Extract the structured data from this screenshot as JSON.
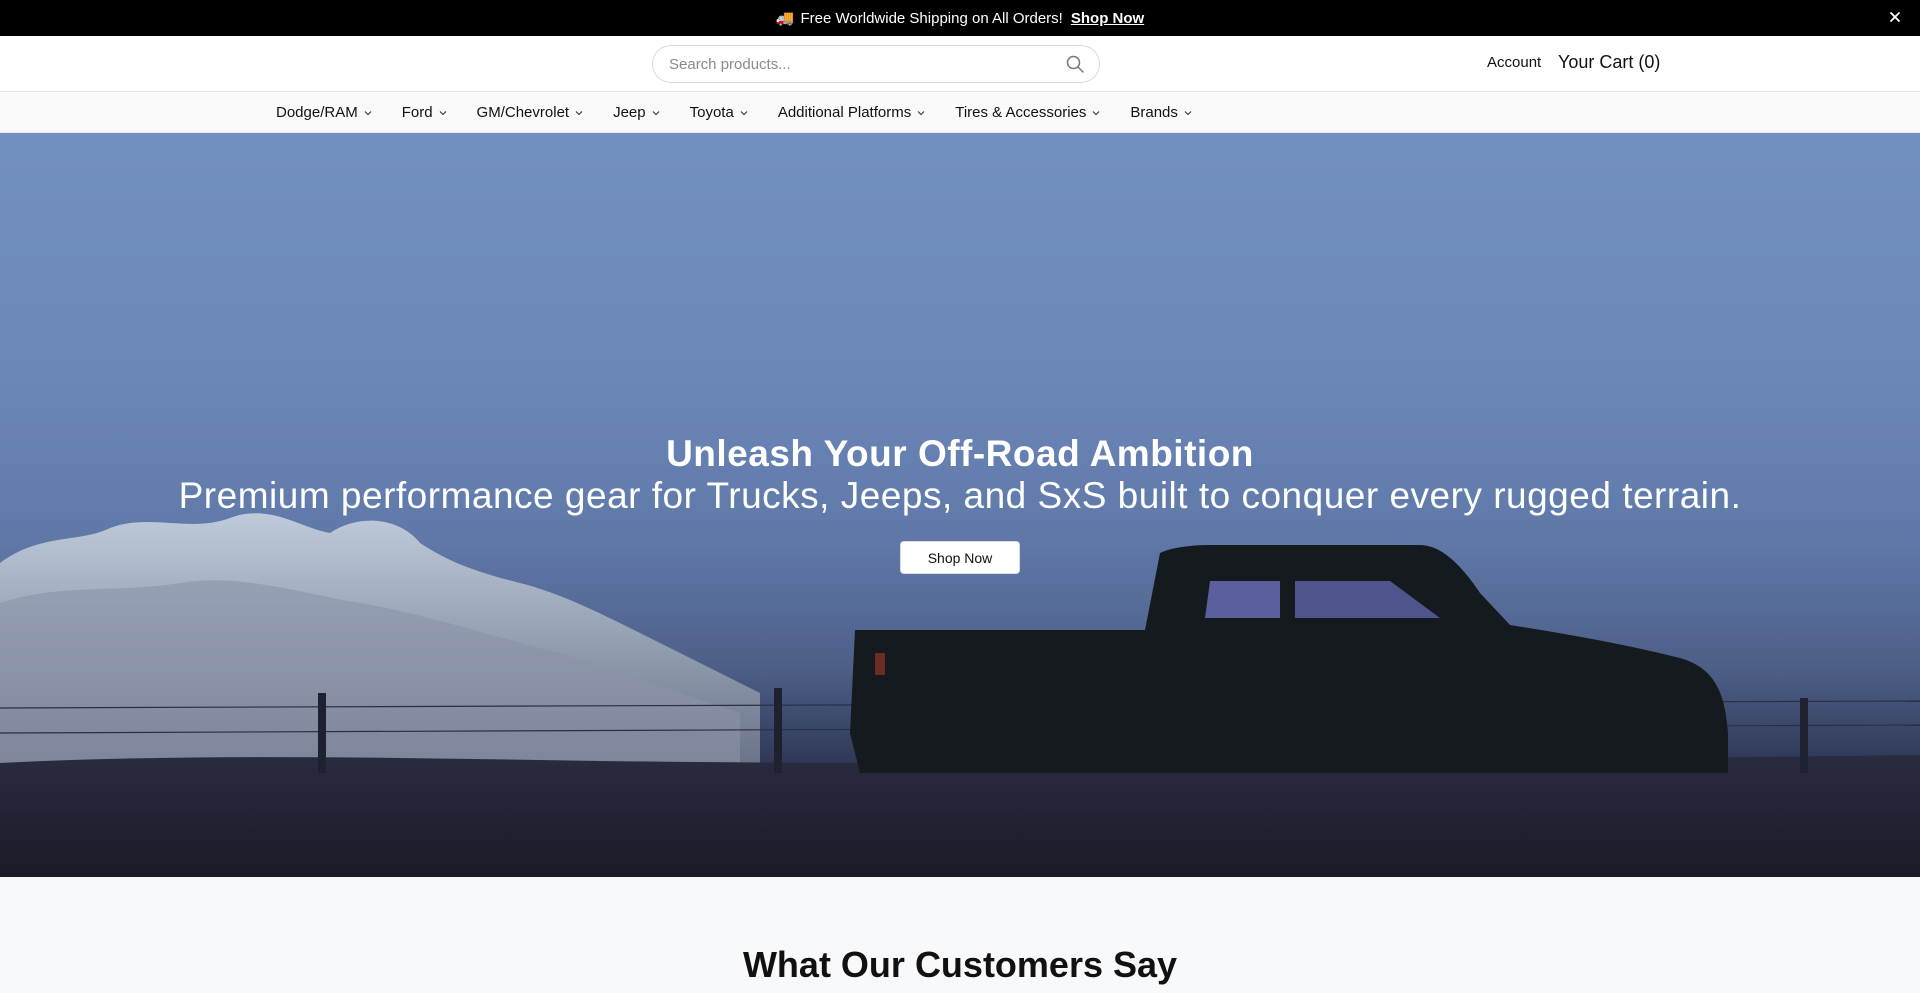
{
  "announcement": {
    "icon": "truck-icon",
    "message": "Free Worldwide Shipping on All Orders!",
    "link": "Shop Now",
    "close_icon": "close-icon"
  },
  "header": {
    "search_placeholder": "Search products...",
    "search_icon": "search-icon",
    "account": "Account",
    "cart": "Your Cart (0)"
  },
  "nav": {
    "items": [
      {
        "label": "Dodge/RAM"
      },
      {
        "label": "Ford"
      },
      {
        "label": "GM/Chevrolet"
      },
      {
        "label": "Jeep"
      },
      {
        "label": "Toyota"
      },
      {
        "label": "Additional Platforms"
      },
      {
        "label": "Tires & Accessories"
      },
      {
        "label": "Brands"
      }
    ]
  },
  "hero": {
    "headline": "Unleash Your Off-Road Ambition",
    "subline": "Premium performance gear for Trucks, Jeeps, and SxS built to conquer every rugged terrain.",
    "cta": "Shop Now"
  },
  "testimonials": {
    "title": "What Our Customers Say"
  },
  "colors": {
    "announcement_bg": "#000000",
    "hero_sky": "#6d89bb",
    "section_bg": "#f8f9fb"
  }
}
